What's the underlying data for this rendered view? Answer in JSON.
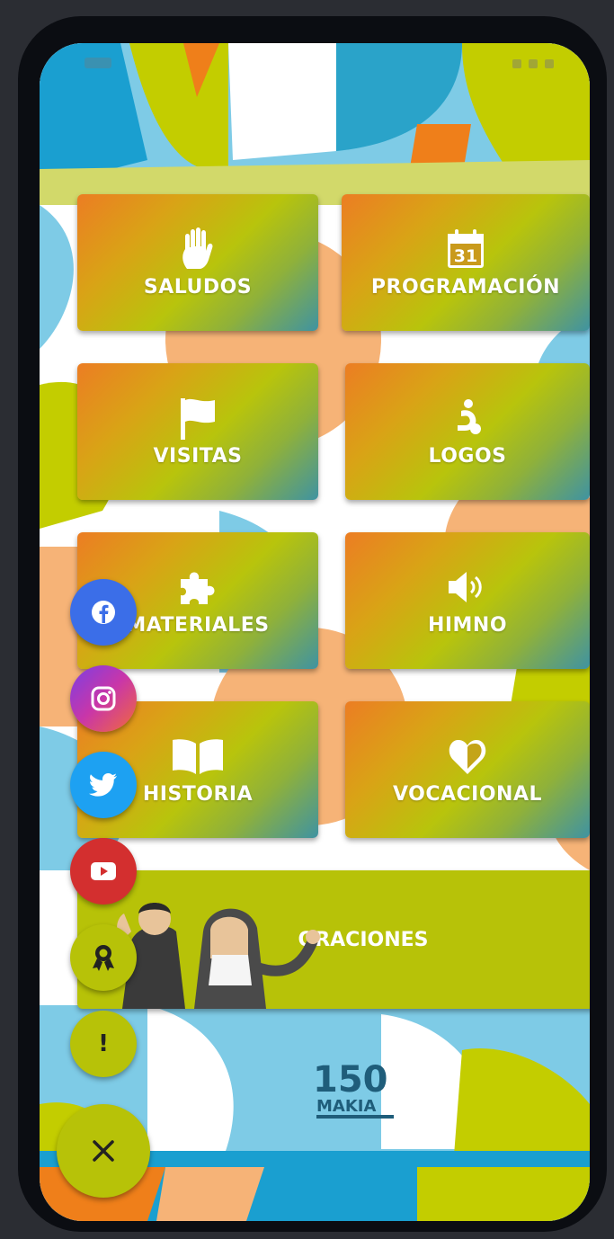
{
  "menu": {
    "tiles": [
      {
        "label": "SALUDOS",
        "icon": "hand-icon"
      },
      {
        "label": "PROGRAMACIÓN",
        "icon": "calendar-icon",
        "day": "31"
      },
      {
        "label": "VISITAS",
        "icon": "flag-icon"
      },
      {
        "label": "LOGOS",
        "icon": "logo-figure-icon"
      },
      {
        "label": "MATERIALES",
        "icon": "puzzle-icon"
      },
      {
        "label": "HIMNO",
        "icon": "speaker-icon"
      },
      {
        "label": "HISTORIA",
        "icon": "book-icon"
      },
      {
        "label": "VOCACIONAL",
        "icon": "heart-icon"
      }
    ],
    "wide": {
      "label": "ORACIONES",
      "illustration": "priest-and-nun-illustration"
    }
  },
  "fabs": [
    {
      "name": "facebook",
      "icon": "facebook-icon",
      "color": "#3b6ee8"
    },
    {
      "name": "instagram",
      "icon": "instagram-icon",
      "color": "#c936a8"
    },
    {
      "name": "twitter",
      "icon": "twitter-icon",
      "color": "#1da1f2"
    },
    {
      "name": "youtube",
      "icon": "youtube-icon",
      "color": "#d32f2f"
    },
    {
      "name": "award",
      "icon": "award-icon",
      "color": "#b7c208"
    },
    {
      "name": "info",
      "icon": "exclamation-icon",
      "color": "#b7c208",
      "text": "!"
    },
    {
      "name": "close",
      "icon": "close-icon",
      "color": "#b7c208"
    }
  ],
  "footer_logo": {
    "text": "150",
    "sub": "MAKIA",
    "icon": "anniversary-logo-icon"
  },
  "colors": {
    "accent": "#b7c208",
    "orange": "#ec7d23",
    "teal": "#3f93a2",
    "sky": "#7ecbe6"
  }
}
